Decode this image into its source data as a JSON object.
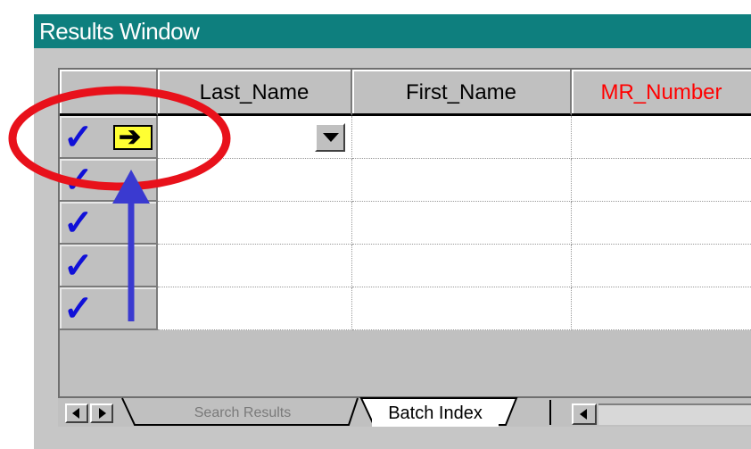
{
  "window": {
    "title": "Results Window"
  },
  "grid": {
    "columns": [
      "Last_Name",
      "First_Name",
      "MR_Number"
    ],
    "column_colors": [
      "#000000",
      "#000000",
      "#ff0000"
    ],
    "rows": [
      {
        "checked": "✓",
        "last_name": "",
        "first_name": "",
        "mr_number": ""
      },
      {
        "checked": "✓",
        "last_name": "",
        "first_name": "",
        "mr_number": ""
      },
      {
        "checked": "✓",
        "last_name": "",
        "first_name": "",
        "mr_number": ""
      },
      {
        "checked": "✓",
        "last_name": "",
        "first_name": "",
        "mr_number": ""
      },
      {
        "checked": "✓",
        "last_name": "",
        "first_name": "",
        "mr_number": ""
      }
    ],
    "current_row_icon": "arrow-right-icon"
  },
  "tabs": [
    {
      "label": "Search Results",
      "active": false
    },
    {
      "label": "Batch Index",
      "active": true
    }
  ],
  "annotations": {
    "highlight_color": "#e8111b",
    "arrow_color": "#3a3ad0"
  }
}
